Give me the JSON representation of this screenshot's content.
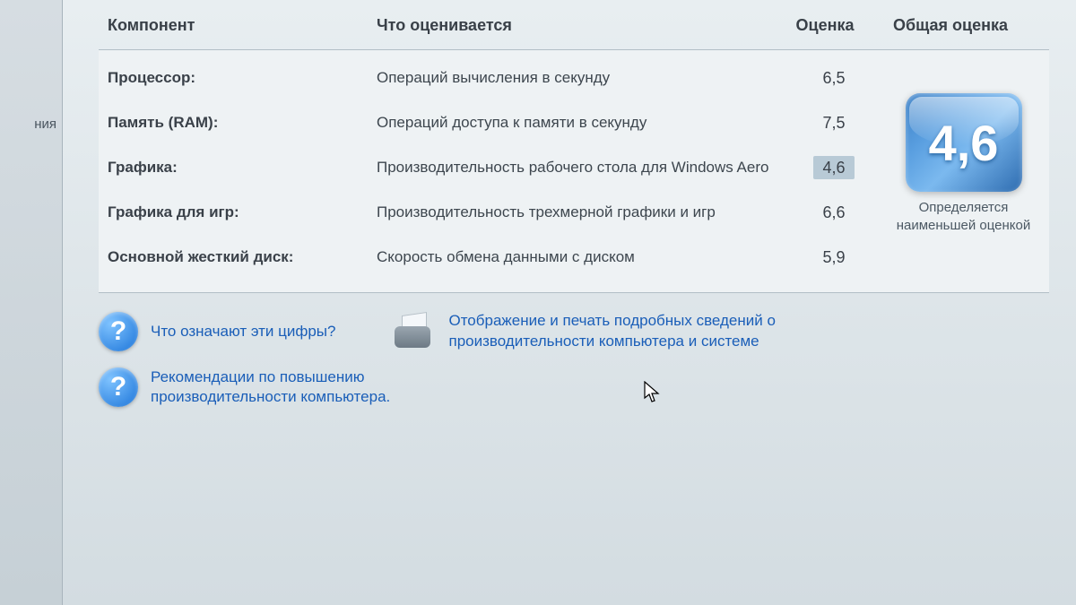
{
  "sidebar_fragment": "ния",
  "headers": {
    "component": "Компонент",
    "rated": "Что оценивается",
    "score": "Оценка",
    "total": "Общая оценка"
  },
  "rows": [
    {
      "component": "Процессор:",
      "rated": "Операций вычисления в секунду",
      "score": "6,5",
      "highlighted": false
    },
    {
      "component": "Память (RAM):",
      "rated": "Операций доступа к памяти в секунду",
      "score": "7,5",
      "highlighted": false
    },
    {
      "component": "Графика:",
      "rated": "Производительность рабочего стола для Windows Aero",
      "score": "4,6",
      "highlighted": true
    },
    {
      "component": "Графика для игр:",
      "rated": "Производительность трехмерной графики и игр",
      "score": "6,6",
      "highlighted": false
    },
    {
      "component": "Основной жесткий диск:",
      "rated": "Скорость обмена данными с диском",
      "score": "5,9",
      "highlighted": false
    }
  ],
  "total_score": "4,6",
  "total_caption": "Определяется наименьшей оценкой",
  "links": {
    "help": "Что означают эти цифры?",
    "print": "Отображение и печать подробных сведений о производительности компьютера и системе",
    "tips": "Рекомендации по повышению производительности компьютера."
  }
}
